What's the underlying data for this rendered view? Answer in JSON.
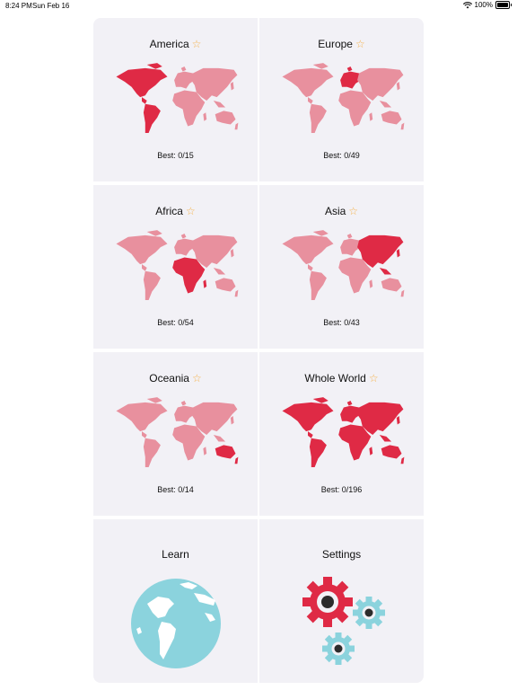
{
  "status_bar": {
    "time": "8:24 PM",
    "date": "Sun Feb 16",
    "battery": "100%",
    "icons": [
      "wifi-icon",
      "battery-icon"
    ]
  },
  "colors": {
    "highlight": "#df2a45",
    "muted": "#e8909e",
    "card_bg": "#f2f1f6",
    "star": "#f5b24a",
    "globe_sea": "#8bd3dd"
  },
  "quizzes": [
    {
      "title": "America",
      "best": "Best: 0/15",
      "highlight": "america"
    },
    {
      "title": "Europe",
      "best": "Best: 0/49",
      "highlight": "europe"
    },
    {
      "title": "Africa",
      "best": "Best: 0/54",
      "highlight": "africa"
    },
    {
      "title": "Asia",
      "best": "Best: 0/43",
      "highlight": "asia"
    },
    {
      "title": "Oceania",
      "best": "Best: 0/14",
      "highlight": "oceania"
    },
    {
      "title": "Whole World",
      "best": "Best: 0/196",
      "highlight": "all"
    }
  ],
  "star_glyph": "☆",
  "learn": {
    "title": "Learn",
    "icon": "globe-icon"
  },
  "settings": {
    "title": "Settings",
    "icon": "gears-icon"
  }
}
